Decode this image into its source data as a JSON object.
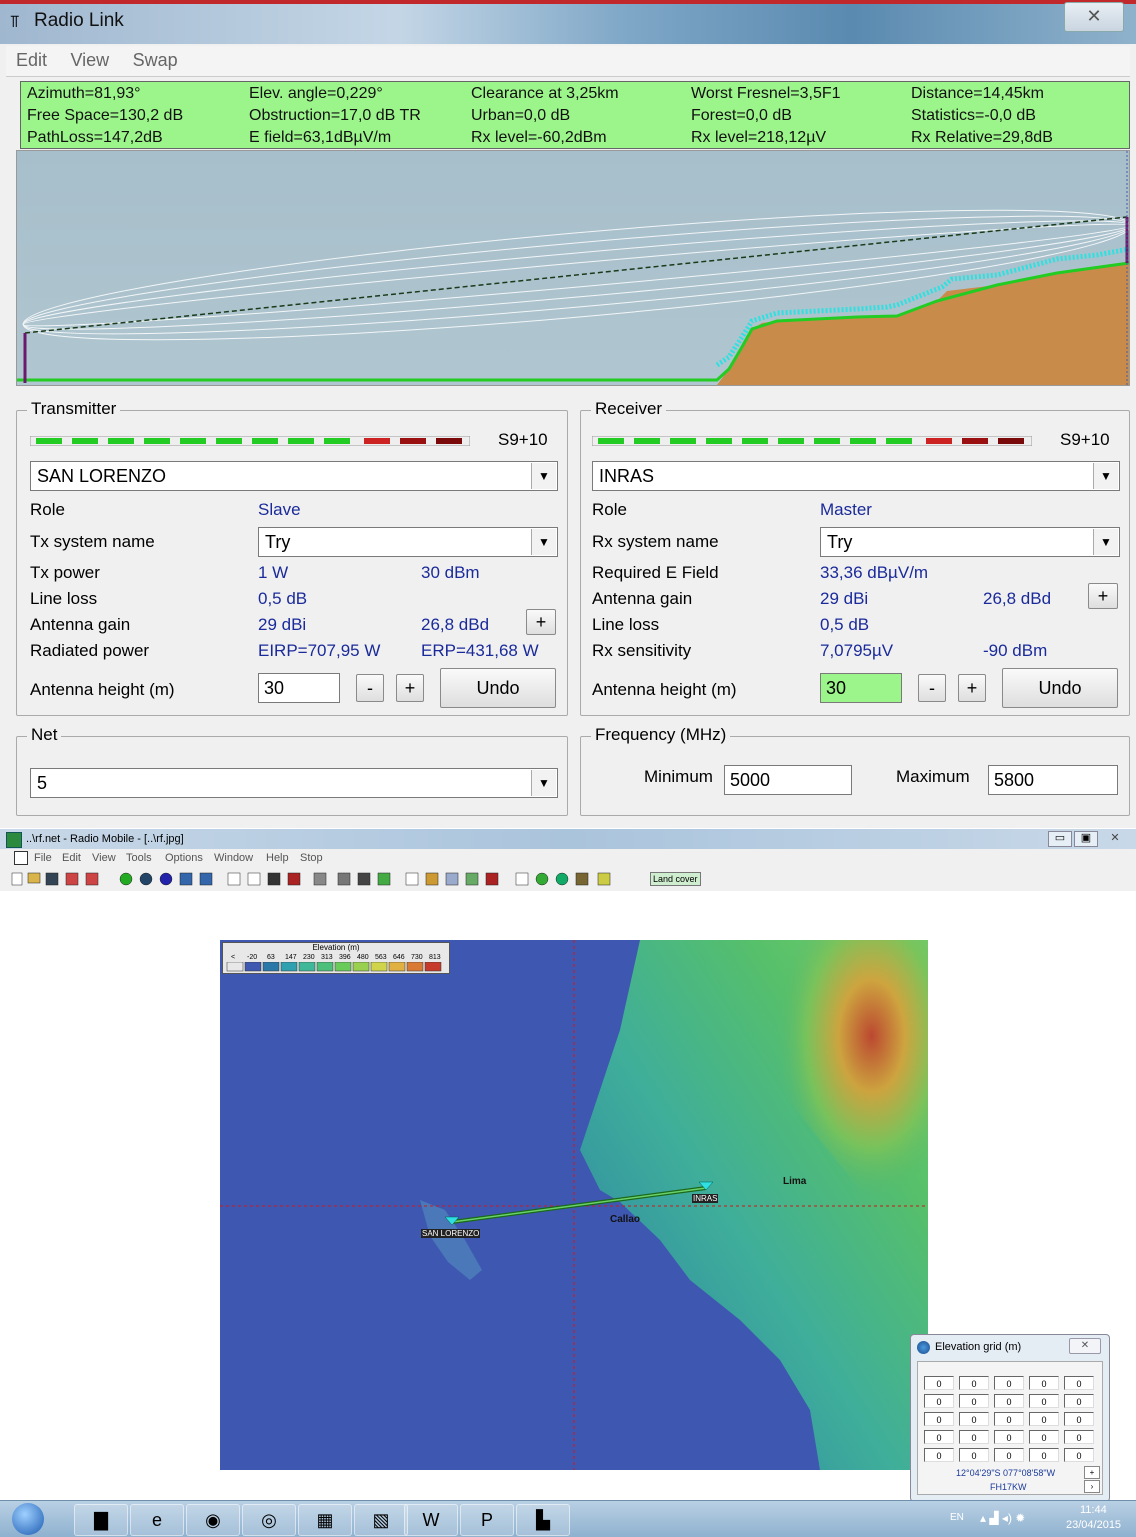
{
  "radio_link": {
    "title": "Radio Link",
    "menu": [
      "Edit",
      "View",
      "Swap"
    ],
    "stats": [
      [
        "Azimuth=81,93°",
        "Elev. angle=0,229°",
        "Clearance at 3,25km",
        "Worst Fresnel=3,5F1",
        "Distance=14,45km"
      ],
      [
        "Free Space=130,2 dB",
        "Obstruction=17,0 dB TR",
        "Urban=0,0 dB",
        "Forest=0,0 dB",
        "Statistics=-0,0 dB"
      ],
      [
        "PathLoss=147,2dB",
        "E field=63,1dBµV/m",
        "Rx level=-60,2dBm",
        "Rx level=218,12µV",
        "Rx Relative=29,8dB"
      ]
    ]
  },
  "transmitter": {
    "group_label": "Transmitter",
    "signal": "S9+10",
    "station": "SAN LORENZO",
    "role_label": "Role",
    "role": "Slave",
    "sysname_label": "Tx system name",
    "sysname": "Try",
    "power_label": "Tx power",
    "power_w": "1 W",
    "power_dbm": "30 dBm",
    "loss_label": "Line loss",
    "loss": "0,5 dB",
    "gain_label": "Antenna gain",
    "gain_dbi": "29 dBi",
    "gain_dbd": "26,8 dBd",
    "plus": "+",
    "radiated_label": "Radiated power",
    "eirp": "EIRP=707,95 W",
    "erp": "ERP=431,68 W",
    "height_label": "Antenna height (m)",
    "height": "30",
    "minus": "-",
    "undo": "Undo"
  },
  "receiver": {
    "group_label": "Receiver",
    "signal": "S9+10",
    "station": "INRAS",
    "role_label": "Role",
    "role": "Master",
    "sysname_label": "Rx system name",
    "sysname": "Try",
    "field_label": "Required E Field",
    "field": "33,36 dBµV/m",
    "gain_label": "Antenna gain",
    "gain_dbi": "29 dBi",
    "gain_dbd": "26,8 dBd",
    "plus": "+",
    "loss_label": "Line loss",
    "loss": "0,5 dB",
    "sens_label": "Rx sensitivity",
    "sens_uv": "7,0795µV",
    "sens_dbm": "-90 dBm",
    "height_label": "Antenna height (m)",
    "height": "30",
    "minus": "-",
    "undo": "Undo"
  },
  "net": {
    "group_label": "Net",
    "value": "5"
  },
  "frequency": {
    "group_label": "Frequency (MHz)",
    "min_label": "Minimum",
    "min": "5000",
    "max_label": "Maximum",
    "max": "5800"
  },
  "radio_mobile": {
    "title": "..\\rf.net - Radio Mobile - [..\\rf.jpg]",
    "menu": [
      "File",
      "Edit",
      "View",
      "Tools",
      "Options",
      "Window",
      "Help",
      "Stop"
    ],
    "land_cover": "Land cover",
    "legend_title": "Elevation (m)",
    "legend_values": [
      "<",
      "-20",
      "63",
      "147",
      "230",
      "313",
      "396",
      "480",
      "563",
      "646",
      "730",
      "813"
    ],
    "map_labels": {
      "san_lorenzo": "SAN LORENZO",
      "inras": "INRAS",
      "callao": "Callao",
      "lima": "Lima"
    }
  },
  "elevation_grid": {
    "title": "Elevation grid (m)",
    "rows": [
      [
        "0",
        "0",
        "0",
        "0",
        "0"
      ],
      [
        "0",
        "0",
        "0",
        "0",
        "0"
      ],
      [
        "0",
        "0",
        "0",
        "0",
        "0"
      ],
      [
        "0",
        "0",
        "0",
        "0",
        "0"
      ],
      [
        "0",
        "0",
        "0",
        "0",
        "0"
      ]
    ],
    "coords": "12°04'29\"S 077°08'58\"W",
    "locator": "FH17KW",
    "plus": "+"
  },
  "taskbar": {
    "lang": "EN",
    "time": "11:44",
    "date": "23/04/2015"
  },
  "colors": {
    "stats_bg": "#9cf58a",
    "value_blue": "#1a2a9a",
    "meter_green": "#22cc22",
    "meter_red": "#cc2222"
  }
}
